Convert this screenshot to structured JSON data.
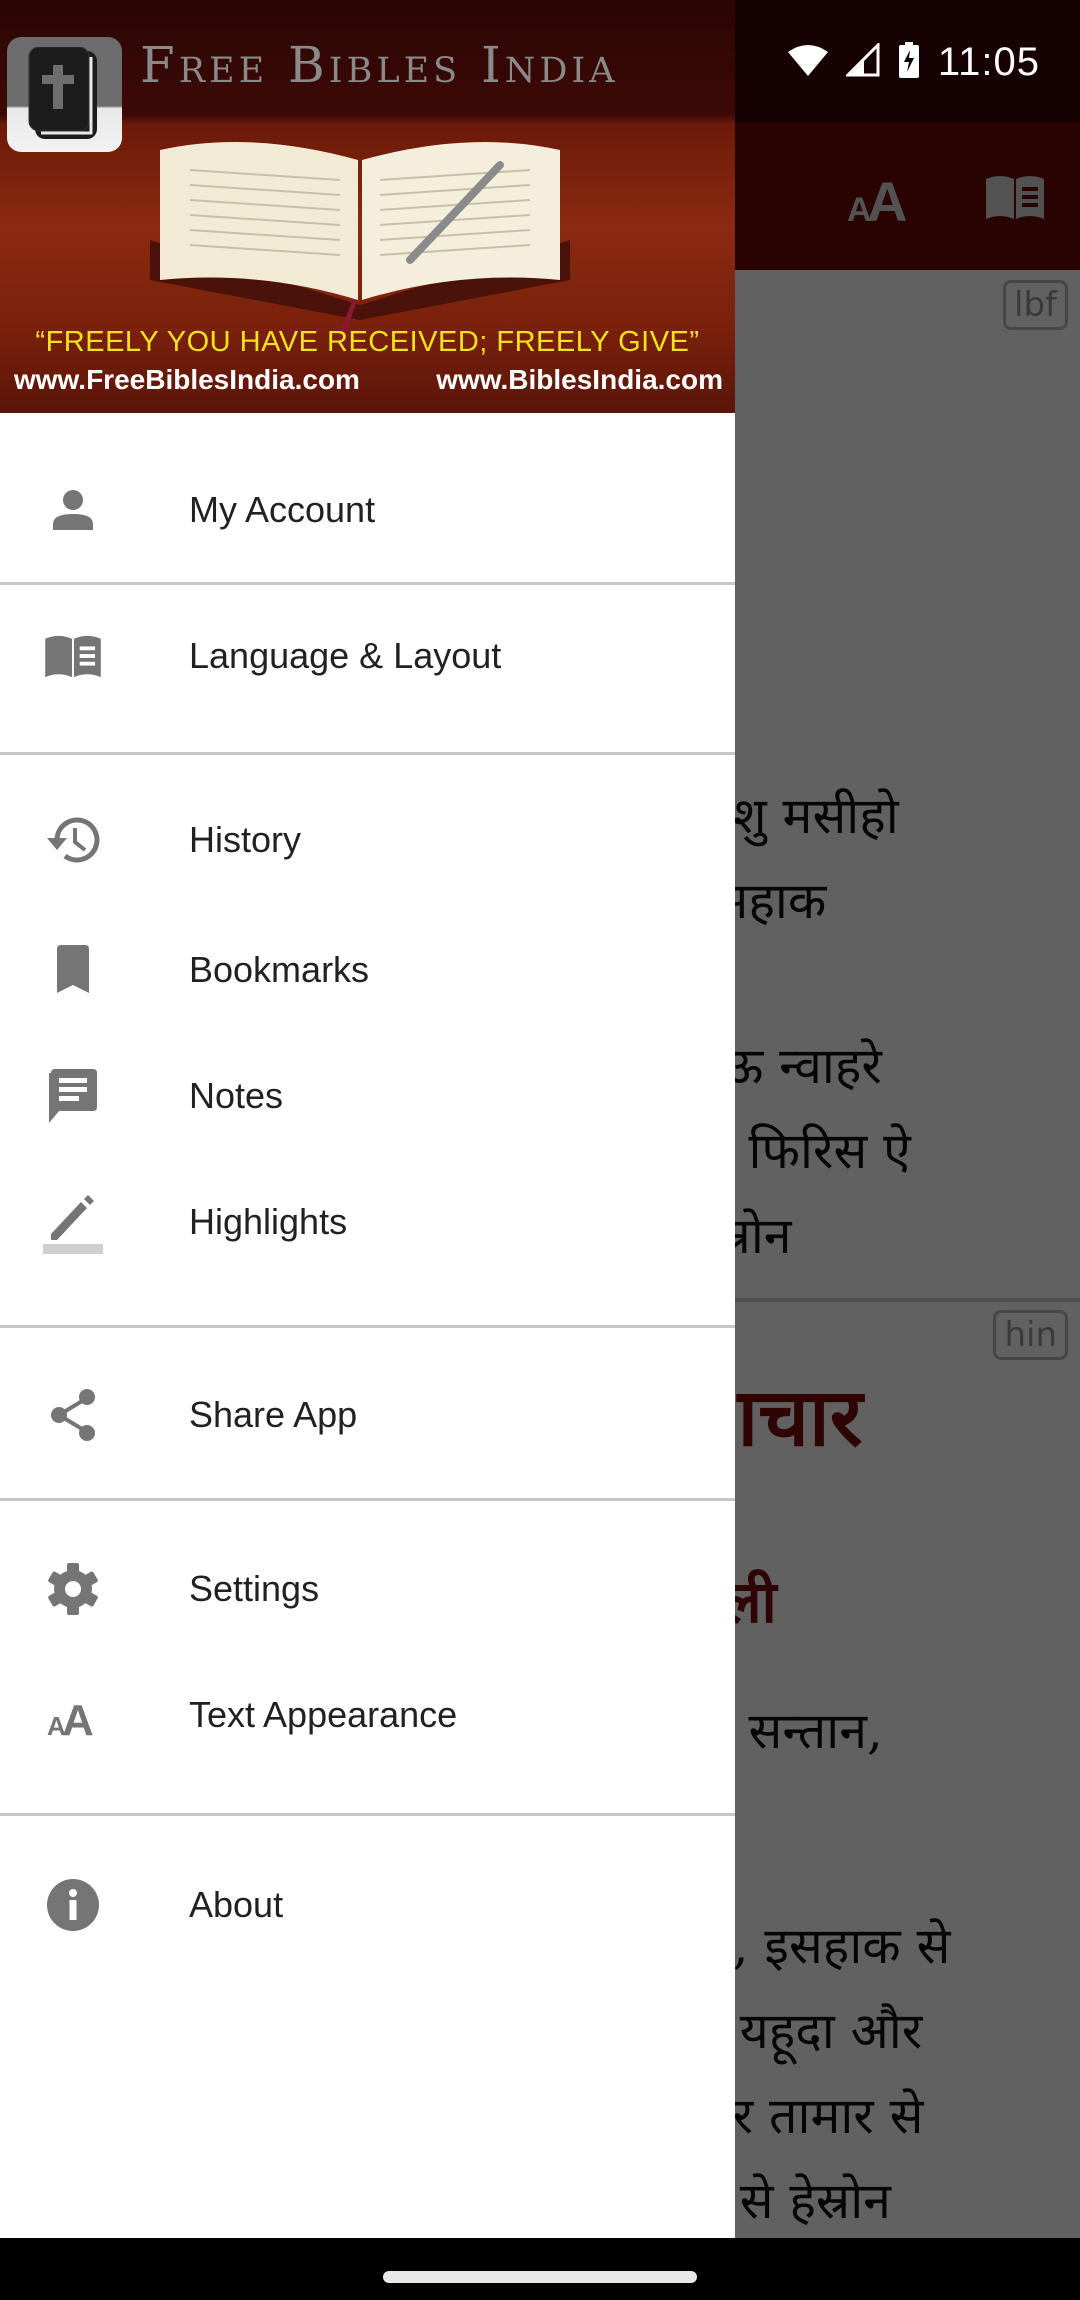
{
  "status_bar": {
    "time": "11:05",
    "icons": [
      "wifi-icon",
      "cellular-signal-icon",
      "battery-charging-icon"
    ]
  },
  "background_app": {
    "toolbar_icons": [
      "text-size-icon",
      "book-open-icon"
    ],
    "pane_top": {
      "language_badge": "lbf",
      "lines": [
        "ीशु मसीहो",
        "इसहाक",
        "शेऊ न्वाहरे",
        "ी फिरिस ऐ",
        "हेस्रोन"
      ]
    },
    "pane_bottom": {
      "language_badge": "hin",
      "heading": "ाचार",
      "subheading": "वली",
      "lines": [
        "ी सन्तान,",
        "ा, इसहाक से",
        "से यहूदा और",
        "ौर तामार से",
        "स से हेस्रोन"
      ]
    }
  },
  "drawer": {
    "header": {
      "title": "Free Bibles India",
      "quote": "“FREELY YOU HAVE RECEIVED; FREELY GIVE”",
      "url_left": "www.FreeBiblesIndia.com",
      "url_right": "www.BiblesIndia.com",
      "logo_icon": "bible-cross-icon"
    },
    "groups": [
      {
        "items": [
          {
            "label": "My Account",
            "icon": "person-icon"
          }
        ]
      },
      {
        "items": [
          {
            "label": "Language & Layout",
            "icon": "book-open-icon"
          }
        ]
      },
      {
        "items": [
          {
            "label": "History",
            "icon": "history-icon"
          },
          {
            "label": "Bookmarks",
            "icon": "bookmark-icon"
          },
          {
            "label": "Notes",
            "icon": "notes-icon"
          },
          {
            "label": "Highlights",
            "icon": "highlight-pen-icon"
          }
        ]
      },
      {
        "items": [
          {
            "label": "Share App",
            "icon": "share-icon"
          }
        ]
      },
      {
        "items": [
          {
            "label": "Settings",
            "icon": "gear-icon"
          },
          {
            "label": "Text Appearance",
            "icon": "text-size-icon"
          }
        ]
      },
      {
        "items": [
          {
            "label": "About",
            "icon": "info-icon"
          }
        ]
      }
    ]
  },
  "colors": {
    "toolbar": "#6e0a0a",
    "icon_gray": "#757575",
    "menu_text": "#212121",
    "divider": "#c6c6c6",
    "quote_yellow": "#f2e21a"
  }
}
